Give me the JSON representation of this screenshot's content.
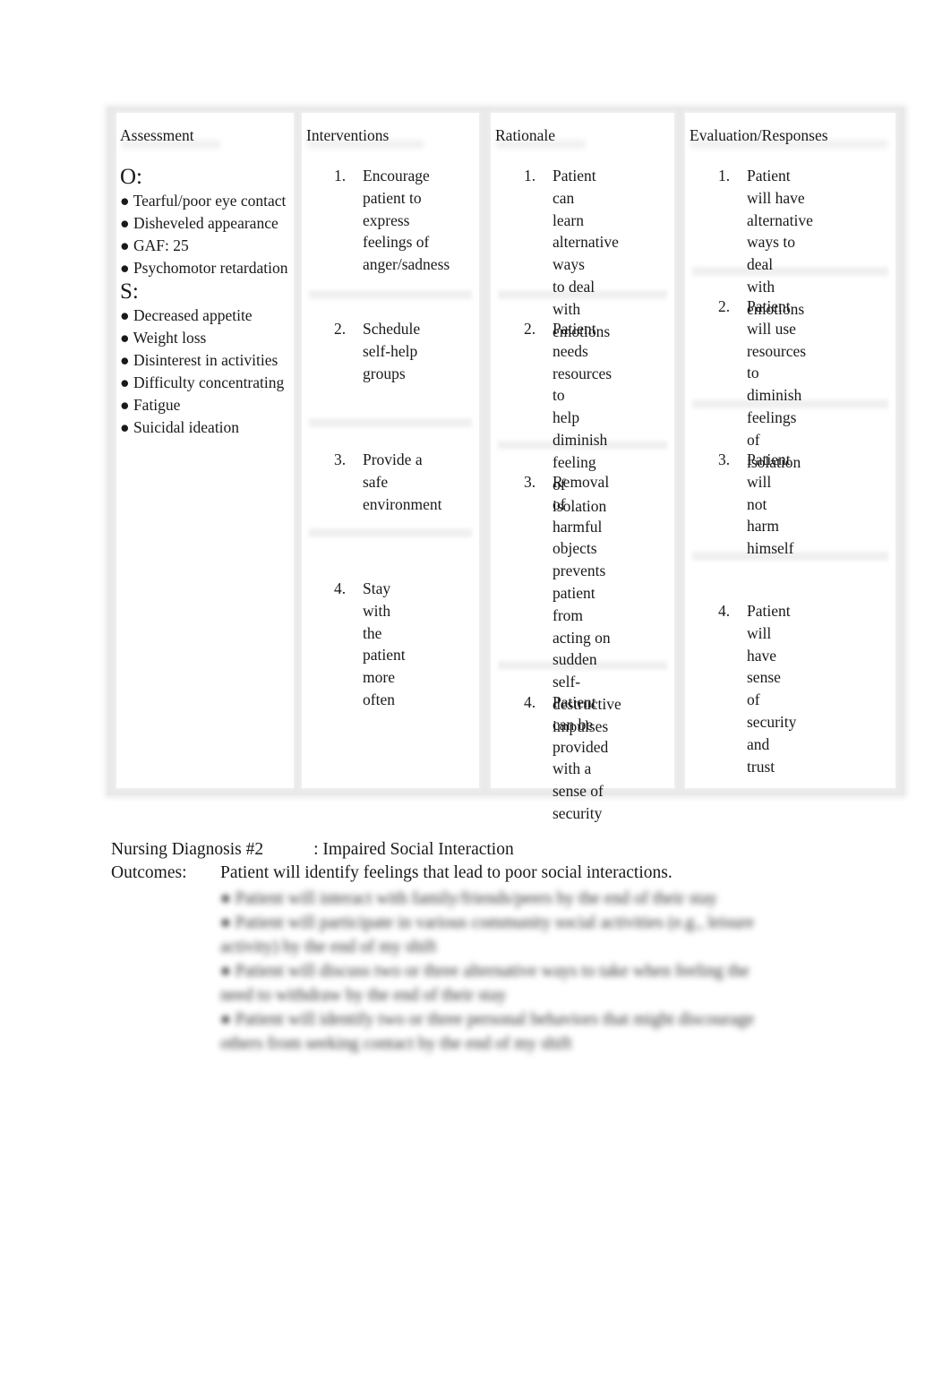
{
  "care_plan_table": {
    "headers": {
      "assessment": "Assessment",
      "interventions": "Interventions",
      "rationale": "Rationale",
      "evaluation": "Evaluation/Responses"
    },
    "assessment": {
      "objective_label": "O:",
      "objective_items": [
        "● Tearful/poor eye contact",
        "● Disheveled appearance",
        "● GAF: 25",
        "● Psychomotor retardation"
      ],
      "subjective_label": "S:",
      "subjective_items": [
        "● Decreased appetite",
        "● Weight loss",
        "● Disinterest in activities",
        "● Difficulty concentrating",
        "● Fatigue",
        "● Suicidal ideation"
      ]
    },
    "interventions": [
      {
        "num": "1.",
        "text": "Encourage\npatient to\nexpress\nfeelings of\nanger/sadness"
      },
      {
        "num": "2.",
        "text": "Schedule\nself-help\ngroups"
      },
      {
        "num": "3.",
        "text": "Provide a safe\nenvironment"
      },
      {
        "num": "4.",
        "text": "Stay with the\npatient more\noften"
      }
    ],
    "rationale": [
      {
        "num": "1.",
        "text": "Patient can\nlearn\nalternative ways\nto deal with\nemotions"
      },
      {
        "num": "2.",
        "text": "Patient needs\nresources to\nhelp diminish\nfeeling of\nisolation"
      },
      {
        "num": "3.",
        "text": "Removal of\nharmful objects\nprevents\npatient from\nacting on\nsudden\nself-destructive\nimpulses"
      },
      {
        "num": "4.",
        "text": "Patient can be\nprovided with a\nsense of\nsecurity"
      }
    ],
    "evaluation": [
      {
        "num": "1.",
        "text": "Patient will have\nalternative ways to\ndeal\nwith emotions"
      },
      {
        "num": "2.",
        "text": "Patient will use\nresources to\ndiminish feelings\nof isolation"
      },
      {
        "num": "3.",
        "text": "Patient will not\nharm himself"
      },
      {
        "num": "4.",
        "text": "Patient will have\nsense of security\nand trust"
      }
    ]
  },
  "diagnosis": {
    "label": "Nursing Diagnosis #2",
    "value": ": Impaired Social Interaction",
    "outcomes_label": "Outcomes:",
    "outcome_first": "Patient will identify feelings that lead to poor social interactions.",
    "blurred_lines": [
      "● Patient will interact with family/friends/peers by the end of their stay",
      "● Patient will participate in various community social activities (e.g., leisure",
      "activity) by the end of my shift",
      "● Patient will discuss two or three alternative ways to take when feeling the",
      "need to withdraw by the end of their stay",
      "● Patient will identify two or three personal behaviors that might discourage",
      "others from seeking contact by the end of my shift"
    ]
  }
}
